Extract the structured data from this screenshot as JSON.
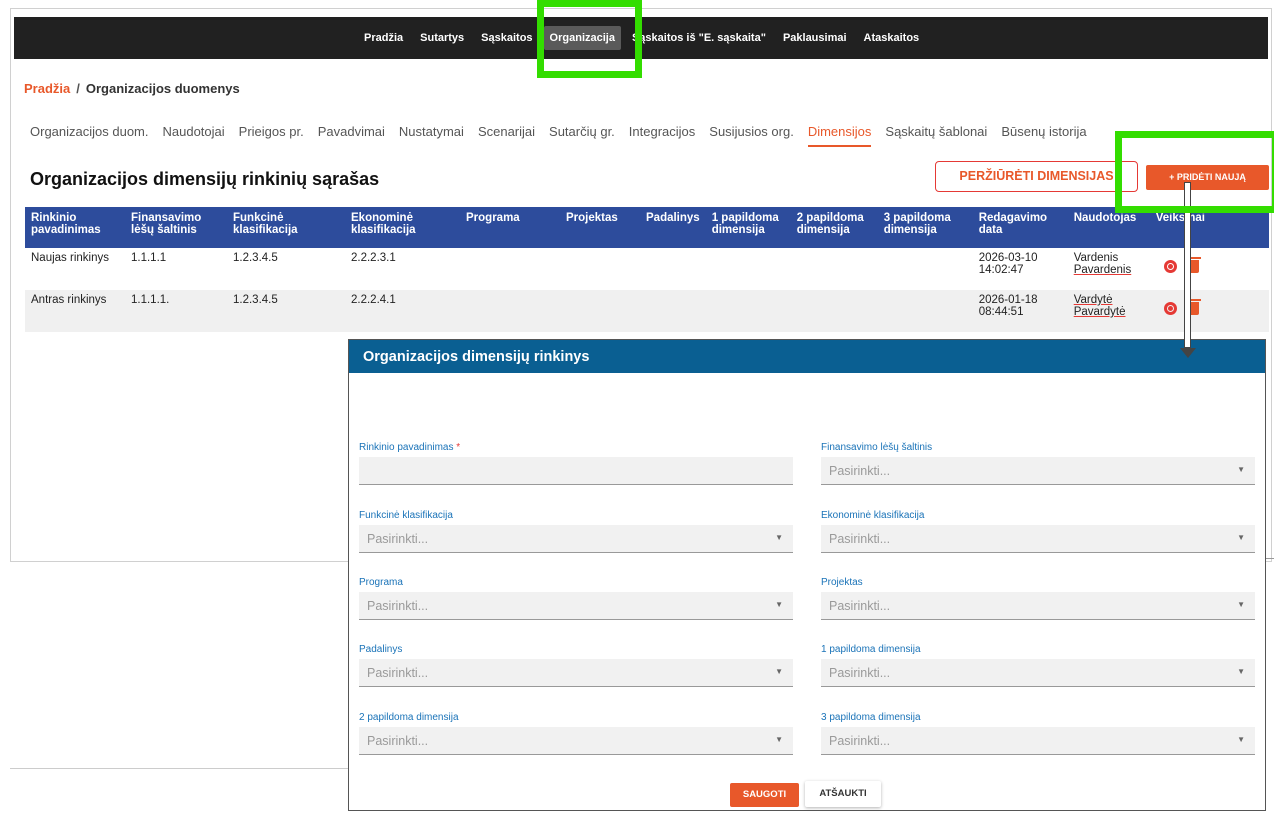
{
  "nav": {
    "items": [
      {
        "label": "Pradžia"
      },
      {
        "label": "Sutartys"
      },
      {
        "label": "Sąskaitos"
      },
      {
        "label": "Organizacija"
      },
      {
        "label": "Sąskaitos iš \"E. sąskaita\""
      },
      {
        "label": "Paklausimai"
      },
      {
        "label": "Ataskaitos"
      }
    ],
    "active": "Organizacija"
  },
  "breadcrumb": {
    "home": "Pradžia",
    "separator": "/",
    "current": "Organizacijos duomenys"
  },
  "tabs": [
    {
      "label": "Organizacijos duom."
    },
    {
      "label": "Naudotojai"
    },
    {
      "label": "Prieigos pr."
    },
    {
      "label": "Pavadvimai"
    },
    {
      "label": "Nustatymai"
    },
    {
      "label": "Scenarijai"
    },
    {
      "label": "Sutarčių gr."
    },
    {
      "label": "Integracijos"
    },
    {
      "label": "Susijusios org."
    },
    {
      "label": "Dimensijos"
    },
    {
      "label": "Sąskaitų šablonai"
    },
    {
      "label": "Būsenų istorija"
    }
  ],
  "active_tab": "Dimensijos",
  "page": {
    "title": "Organizacijos dimensijų rinkinių sąrašas",
    "view_button": "PERŽIŪRĖTI DIMENSIJAS",
    "add_button": "+ PRIDĖTI NAUJĄ"
  },
  "table": {
    "headers": [
      "Rinkinio pavadinimas",
      "Finansavimo lėšų šaltinis",
      "Funkcinė klasifikacija",
      "Ekonominė klasifikacija",
      "Programa",
      "Projektas",
      "Padalinys",
      "1 papildoma dimensija",
      "2 papildoma dimensija",
      "3 papildoma dimensija",
      "Redagavimo data",
      "Naudotojas",
      "Veiksmai"
    ],
    "rows": [
      {
        "name": "Naujas rinkinys",
        "fin": "1.1.1.1",
        "func": "1.2.3.4.5",
        "eko": "2.2.2.3.1",
        "prog": "",
        "proj": "",
        "pad": "",
        "d1": "",
        "d2": "",
        "d3": "",
        "date": "2026-03-10 14:02:47",
        "user_first": "Vardenis",
        "user_last": "Pavardenis"
      },
      {
        "name": "Antras rinkinys",
        "fin": "1.1.1.1.",
        "func": "1.2.3.4.5",
        "eko": "2.2.2.4.1",
        "prog": "",
        "proj": "",
        "pad": "",
        "d1": "",
        "d2": "",
        "d3": "",
        "date": "2026-01-18 08:44:51",
        "user_first": "Vardytė",
        "user_last": "Pavardytė"
      }
    ]
  },
  "modal": {
    "title": "Organizacijos dimensijų rinkinys",
    "fields": {
      "name": {
        "label": "Rinkinio pavadinimas",
        "required_mark": "*",
        "value": ""
      },
      "fin": {
        "label": "Finansavimo lėšų šaltinis",
        "placeholder": "Pasirinkti..."
      },
      "func": {
        "label": "Funkcinė klasifikacija",
        "placeholder": "Pasirinkti..."
      },
      "eko": {
        "label": "Ekonominė klasifikacija",
        "placeholder": "Pasirinkti..."
      },
      "prog": {
        "label": "Programa",
        "placeholder": "Pasirinkti..."
      },
      "proj": {
        "label": "Projektas",
        "placeholder": "Pasirinkti..."
      },
      "pad": {
        "label": "Padalinys",
        "placeholder": "Pasirinkti..."
      },
      "d1": {
        "label": "1 papildoma dimensija",
        "placeholder": "Pasirinkti..."
      },
      "d2": {
        "label": "2 papildoma dimensija",
        "placeholder": "Pasirinkti..."
      },
      "d3": {
        "label": "3 papildoma dimensija",
        "placeholder": "Pasirinkti..."
      }
    },
    "save_button": "SAUGOTI",
    "cancel_button": "ATŠAUKTI"
  },
  "colors": {
    "accent": "#e8582a",
    "nav_bg": "#212121",
    "table_header": "#2d4c9c",
    "modal_header": "#0a5f92",
    "highlight": "#33dd00"
  }
}
